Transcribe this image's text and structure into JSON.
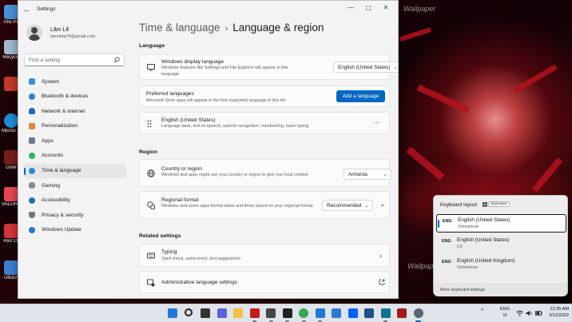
{
  "window": {
    "app_title": "Settings",
    "controls": {
      "minimize": "—",
      "maximize": "▢",
      "close": "✕"
    }
  },
  "profile": {
    "name": "Lâm Lê",
    "email": "lamnhtq74@gmail.com"
  },
  "search": {
    "placeholder": "Find a setting"
  },
  "nav": {
    "items": [
      {
        "label": "System",
        "icon": "monitor-icon",
        "color": "#3b8fd8"
      },
      {
        "label": "Bluetooth & devices",
        "icon": "bluetooth-icon",
        "color": "#2f7fd4"
      },
      {
        "label": "Network & internet",
        "icon": "wifi-icon",
        "color": "#1b6dc1"
      },
      {
        "label": "Personalization",
        "icon": "brush-icon",
        "color": "#e0883a"
      },
      {
        "label": "Apps",
        "icon": "apps-icon",
        "color": "#6b7a8c"
      },
      {
        "label": "Accounts",
        "icon": "person-icon",
        "color": "#2eb06b"
      },
      {
        "label": "Time & language",
        "icon": "globe-clock-icon",
        "color": "#2a8ad6",
        "active": true
      },
      {
        "label": "Gaming",
        "icon": "controller-icon",
        "color": "#8b8b8b"
      },
      {
        "label": "Accessibility",
        "icon": "accessibility-icon",
        "color": "#1f6fbf"
      },
      {
        "label": "Privacy & security",
        "icon": "shield-icon",
        "color": "#777"
      },
      {
        "label": "Windows Update",
        "icon": "update-icon",
        "color": "#1e78d6"
      }
    ]
  },
  "breadcrumb": {
    "parent": "Time & language",
    "separator": "›",
    "current": "Language & region"
  },
  "language_section": {
    "heading": "Language",
    "display_language": {
      "title": "Windows display language",
      "description": "Windows features like Settings and File Explorer will appear in this language",
      "value": "English (United States)"
    },
    "preferred": {
      "title": "Preferred languages",
      "description": "Microsoft Store apps will appear in the first supported language in this list",
      "button": "Add a language"
    },
    "english": {
      "title": "English (United States)",
      "description": "Language pack, text-to-speech, speech recognition, handwriting, basic typing",
      "more": "···"
    }
  },
  "region_section": {
    "heading": "Region",
    "country": {
      "title": "Country or region",
      "description": "Windows and apps might use your country or region to give you local content",
      "value": "Armenia"
    },
    "format": {
      "title": "Regional format",
      "description": "Windows and some apps format dates and times based on your regional format",
      "value": "Recommended"
    }
  },
  "related_section": {
    "heading": "Related settings",
    "typing": {
      "title": "Typing",
      "description": "Spell check, autocorrect, text suggestions"
    },
    "admin": {
      "title": "Administrative language settings"
    }
  },
  "flyout": {
    "title": "Keyboard layout",
    "shortcut": "Spacebar",
    "items": [
      {
        "code": "ENG",
        "name": "English (United States)",
        "sub": "Vietnamese",
        "selected": true
      },
      {
        "code": "ENG",
        "name": "English (United States)",
        "sub": "US",
        "selected": false
      },
      {
        "code": "ENG",
        "name": "English (United Kingdom)",
        "sub": "Vietnamese",
        "selected": false
      }
    ],
    "footer_link": "More keyboard settings"
  },
  "desktop": {
    "icons": [
      {
        "label": "This PC",
        "color": "#4a8fd8"
      },
      {
        "label": "Recycle",
        "color": "#9fb8d0"
      },
      {
        "label": "",
        "color": "#c0392b"
      },
      {
        "label": "Micros Edge",
        "color": "#1f8ad6"
      },
      {
        "label": "GoW",
        "color": "#7a1d1d"
      },
      {
        "label": "VALORA",
        "color": "#e64553"
      },
      {
        "label": "Riot Cli",
        "color": "#d13639"
      },
      {
        "label": "UltraVi",
        "color": "#3c7fd1"
      }
    ],
    "watermark": "Wallpaper"
  },
  "taskbar": {
    "apps": [
      {
        "name": "start-icon",
        "color": "#1e78d6"
      },
      {
        "name": "search-icon",
        "color": "#1f1f1f"
      },
      {
        "name": "task-view-icon",
        "color": "#333333"
      },
      {
        "name": "chat-icon",
        "color": "#5a63d8"
      },
      {
        "name": "file-explorer-icon",
        "color": "#f4c145"
      },
      {
        "name": "netflix-icon",
        "color": "#c41d24"
      },
      {
        "name": "app-icon",
        "color": "#444444"
      },
      {
        "name": "notion-icon",
        "color": "#222222"
      },
      {
        "name": "chrome-icon",
        "color": "#3aa757"
      },
      {
        "name": "app-icon",
        "color": "#1e78d6"
      },
      {
        "name": "store-icon",
        "color": "#2b7cd3"
      },
      {
        "name": "dropbox-icon",
        "color": "#0061fe"
      },
      {
        "name": "app-icon",
        "color": "#1f4f8a"
      },
      {
        "name": "app-icon",
        "color": "#0e7490"
      },
      {
        "name": "app-icon",
        "color": "#a11d1d"
      },
      {
        "name": "settings-icon",
        "color": "#5b6473"
      }
    ],
    "tray_chevron": "^",
    "lang": {
      "code": "ENG",
      "sub": "VI"
    },
    "time": "12:35 AM",
    "date": "3/12/2022"
  }
}
